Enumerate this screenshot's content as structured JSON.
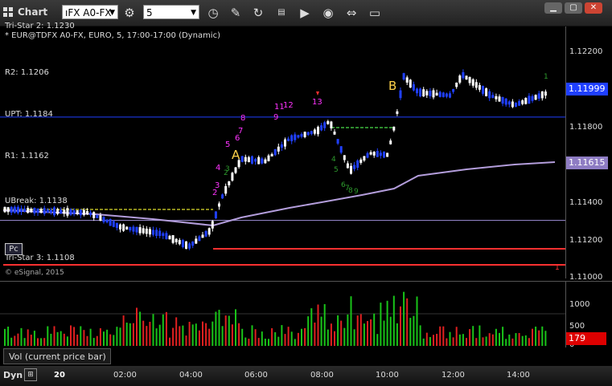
{
  "window": {
    "title": "Chart"
  },
  "toolbar": {
    "symbol": "ıFX A0-FX",
    "interval": "5",
    "icons": [
      "settings-gear-icon",
      "clock-icon",
      "draw-pencil-icon",
      "refresh-icon",
      "gsi-icon",
      "play-icon",
      "tag-icon",
      "link-icon",
      "comment-icon"
    ]
  },
  "chart": {
    "header_line1": "Tri-Star 2: 1.1230",
    "header_line2": "* EUR@TDFX A0-FX, EURO, 5, 17:00-17:00 (Dynamic)",
    "copyright": "© eSignal, 2015",
    "pc_badge": "Pc",
    "levels": [
      {
        "label": "R2: 1.1206",
        "price": 1.1206,
        "color": "#1f3fff"
      },
      {
        "label": "UPT: 1.1184",
        "price": 1.1184,
        "color": "#9e8fd8"
      },
      {
        "label": "R1: 1.1162",
        "price": 1.1162,
        "color": "#1f3fff"
      },
      {
        "label": "UBreak: 1.1138",
        "price": 1.1138,
        "color": "#ff3030"
      },
      {
        "label": "Tri-Star 3: 1.1108",
        "price": 1.1108,
        "color": "#ff3030"
      }
    ],
    "y_ticks": [
      "1.12200",
      "1.11800",
      "1.11400",
      "1.11200",
      "1.11000"
    ],
    "last_price": "1.11999",
    "ma_price": "1.11615",
    "markers": {
      "A": "A",
      "B": "B",
      "magenta": [
        "2",
        "3",
        "4",
        "5",
        "6",
        "7",
        "8",
        "9",
        "11",
        "12",
        "13"
      ],
      "green": [
        "2",
        "3",
        "4",
        "5",
        "6",
        "7",
        "8",
        "9",
        "1"
      ],
      "red": [
        "1"
      ]
    },
    "colors": {
      "up_candle": "#ffffff",
      "down_candle": "#2040ff",
      "ma_line": "#b39ddb",
      "dashed_green": "#2e8b2e",
      "dashed_olive": "#8a8a1a"
    }
  },
  "volume": {
    "label": "Vol (current price bar)",
    "y_ticks": [
      "1000",
      "500",
      "0"
    ],
    "current": "179"
  },
  "time_axis": {
    "mode": "Dyn",
    "ticks": [
      "20",
      "02:00",
      "04:00",
      "06:00",
      "08:00",
      "10:00",
      "12:00",
      "14:00"
    ]
  }
}
